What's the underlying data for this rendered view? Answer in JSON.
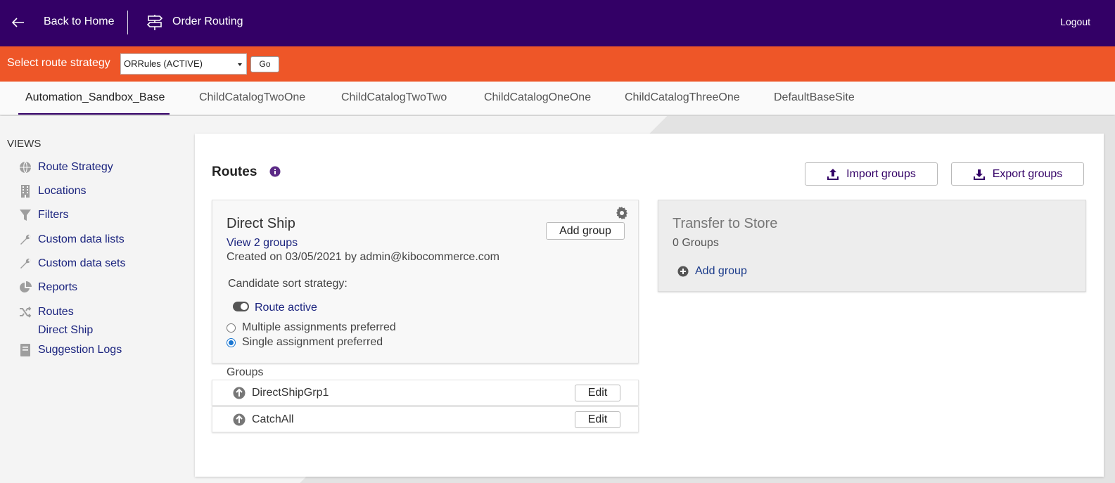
{
  "header": {
    "back_label": "Back to Home",
    "app_title": "Order Routing",
    "logout_label": "Logout",
    "background_color": "#330066"
  },
  "strategy_bar": {
    "label": "Select route strategy",
    "selected_strategy": "ORRules (ACTIVE)",
    "go_label": "Go",
    "background_color": "#ee5628"
  },
  "tabs": [
    {
      "label": "Automation_Sandbox_Base",
      "active": true
    },
    {
      "label": "ChildCatalogTwoOne",
      "active": false
    },
    {
      "label": "ChildCatalogTwoTwo",
      "active": false
    },
    {
      "label": "ChildCatalogOneOne",
      "active": false
    },
    {
      "label": "ChildCatalogThreeOne",
      "active": false
    },
    {
      "label": "DefaultBaseSite",
      "active": false
    }
  ],
  "sidebar": {
    "section_label": "VIEWS",
    "items": [
      {
        "label": "Route Strategy",
        "icon": "globe-icon"
      },
      {
        "label": "Locations",
        "icon": "building-icon"
      },
      {
        "label": "Filters",
        "icon": "filter-icon"
      },
      {
        "label": "Custom data lists",
        "icon": "wrench-icon"
      },
      {
        "label": "Custom data sets",
        "icon": "wrench-icon"
      },
      {
        "label": "Reports",
        "icon": "pie-chart-icon"
      },
      {
        "label": "Routes",
        "icon": "shuffle-icon"
      },
      {
        "label": "Suggestion Logs",
        "icon": "book-icon"
      }
    ],
    "routes_sub_item": "Direct Ship"
  },
  "main": {
    "title": "Routes",
    "import_label": "Import groups",
    "export_label": "Export groups",
    "direct_ship": {
      "name": "Direct Ship",
      "view_groups_link": "View 2 groups",
      "created_text": "Created on 03/05/2021 by admin@kibocommerce.com",
      "add_group_label": "Add group",
      "sort_strategy_label": "Candidate sort strategy:",
      "route_active_label": "Route active",
      "route_active": true,
      "options": [
        {
          "label": "Multiple assignments preferred",
          "checked": false
        },
        {
          "label": "Single assignment preferred",
          "checked": true
        }
      ]
    },
    "groups_label": "Groups",
    "groups": [
      {
        "name": "DirectShipGrp1",
        "edit_label": "Edit"
      },
      {
        "name": "CatchAll",
        "edit_label": "Edit"
      }
    ],
    "transfer_to_store": {
      "name": "Transfer to Store",
      "count_text": "0 Groups",
      "add_group_label": "Add group"
    }
  }
}
